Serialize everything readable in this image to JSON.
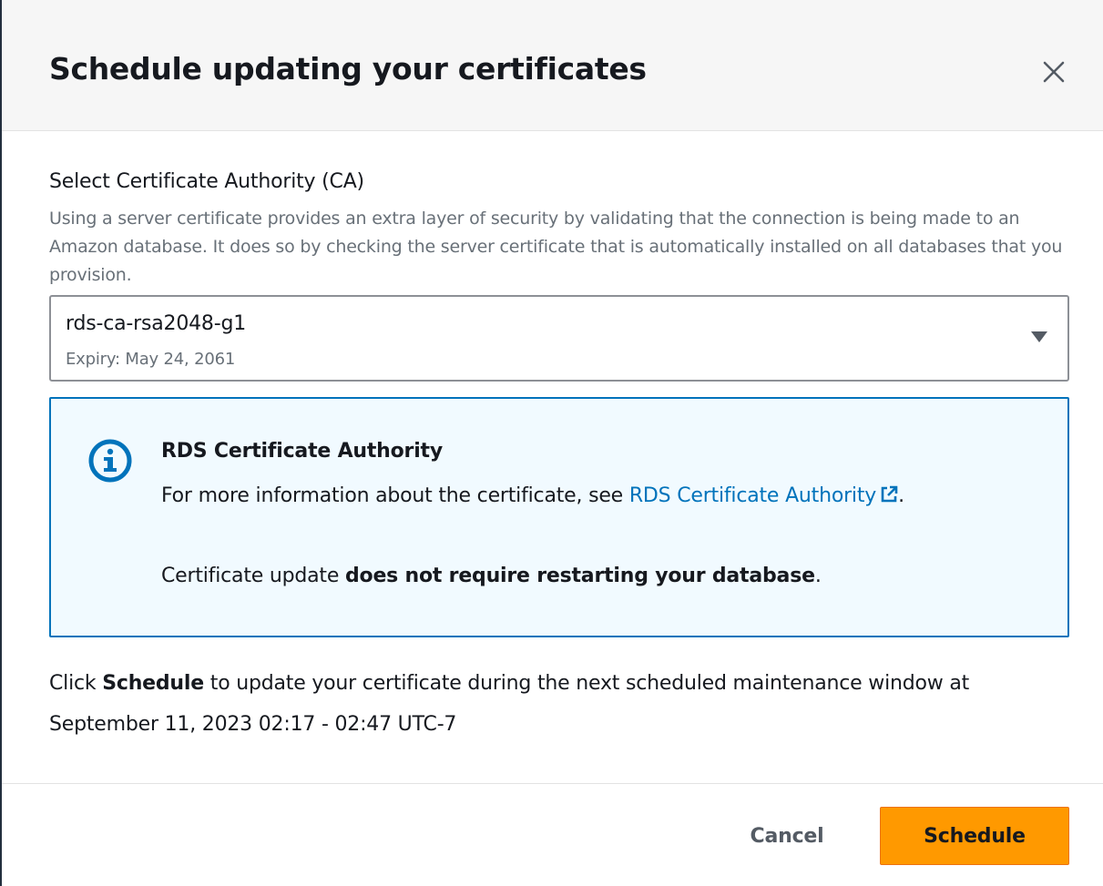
{
  "modal": {
    "title": "Schedule updating your certificates"
  },
  "ca_field": {
    "label": "Select Certificate Authority (CA)",
    "description": "Using a server certificate provides an extra layer of security by validating that the connection is being made to an Amazon database. It does so by checking the server certificate that is automatically installed on all databases that you provision.",
    "selected_value": "rds-ca-rsa2048-g1",
    "selected_sub": "Expiry: May 24, 2061"
  },
  "alert": {
    "title": "RDS Certificate Authority",
    "text_prefix": "For more information about the certificate, see ",
    "link_text": "RDS Certificate Authority",
    "text_suffix": ".",
    "line2_prefix": "Certificate update ",
    "line2_bold": "does not require restarting your database",
    "line2_suffix": "."
  },
  "footnote": {
    "prefix": "Click ",
    "bold": "Schedule",
    "suffix": " to update your certificate during the next scheduled maintenance window at September 11, 2023 02:17 - 02:47 UTC-7"
  },
  "footer": {
    "cancel_label": "Cancel",
    "schedule_label": "Schedule"
  },
  "colors": {
    "primary_button": "#ff9900",
    "link": "#0073bb",
    "alert_background": "#f1faff",
    "alert_border": "#0073bb"
  },
  "icons": {
    "close": "close-icon",
    "dropdown": "caret-down-icon",
    "info": "info-icon",
    "external_link": "external-link-icon"
  }
}
